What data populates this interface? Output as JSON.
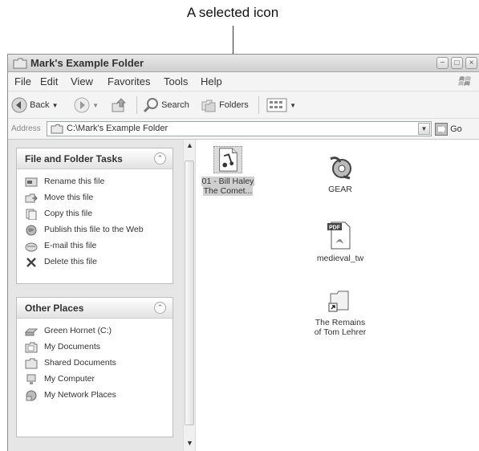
{
  "callout": {
    "text": "A selected icon"
  },
  "window": {
    "title": "Mark's Example Folder",
    "controls": {
      "minimize": "−",
      "maximize": "□",
      "close": "×"
    }
  },
  "menu": [
    "File",
    "Edit",
    "View",
    "Favorites",
    "Tools",
    "Help"
  ],
  "toolbar": {
    "back_label": "Back",
    "search_label": "Search",
    "folders_label": "Folders"
  },
  "address": {
    "label": "Address",
    "value": "C:\\Mark's Example Folder",
    "go_label": "Go"
  },
  "tasks_panel": {
    "title": "File and Folder Tasks",
    "items": [
      {
        "label": "Rename this file",
        "icon": "rename-icon"
      },
      {
        "label": "Move this file",
        "icon": "move-icon"
      },
      {
        "label": "Copy this file",
        "icon": "copy-icon"
      },
      {
        "label": "Publish this file to the Web",
        "icon": "publish-icon"
      },
      {
        "label": "E-mail this file",
        "icon": "email-icon"
      },
      {
        "label": "Delete this file",
        "icon": "delete-icon"
      }
    ]
  },
  "places_panel": {
    "title": "Other Places",
    "items": [
      {
        "label": "Green Hornet (C:)",
        "icon": "drive-icon"
      },
      {
        "label": "My Documents",
        "icon": "documents-icon"
      },
      {
        "label": "Shared Documents",
        "icon": "shared-documents-icon"
      },
      {
        "label": "My Computer",
        "icon": "computer-icon"
      },
      {
        "label": "My Network Places",
        "icon": "network-icon"
      }
    ]
  },
  "files": [
    {
      "label_line1": "01 - Bill Haley",
      "label_line2": "The Comet...",
      "icon": "audio-file-icon",
      "selected": true
    },
    {
      "label_line1": "GEAR",
      "label_line2": "",
      "icon": "gear-app-icon",
      "selected": false
    },
    {
      "label_line1": "medieval_tw",
      "label_line2": "",
      "icon": "pdf-file-icon",
      "selected": false
    },
    {
      "label_line1": "The Remains",
      "label_line2": "of Tom Lehrer",
      "icon": "shortcut-folder-icon",
      "selected": false
    }
  ]
}
